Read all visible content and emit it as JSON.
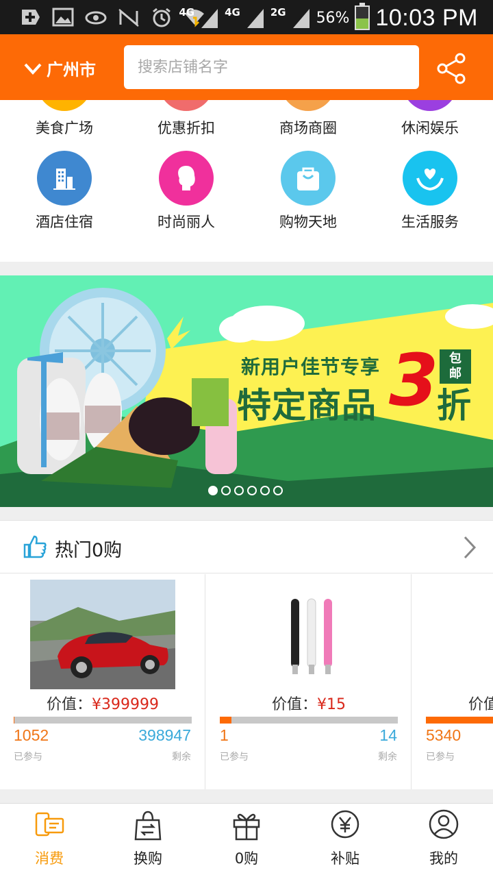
{
  "status_bar": {
    "network_1": "4G",
    "network_2": "4G",
    "network_3": "2G",
    "battery_percent": "56%",
    "time": "10:03 PM",
    "battery_level": 0.46
  },
  "header": {
    "city": "广州市",
    "search_placeholder": "搜索店铺名字",
    "accent_color": "#fd6a06"
  },
  "categories": [
    {
      "label": "美食广场",
      "icon": "food-icon",
      "color": "#ffb300"
    },
    {
      "label": "优惠折扣",
      "icon": "discount-icon",
      "color": "#f06c6c"
    },
    {
      "label": "商场商圈",
      "icon": "mall-icon",
      "color": "#f5a14a"
    },
    {
      "label": "休闲娱乐",
      "icon": "leisure-icon",
      "color": "#9b3fe0"
    },
    {
      "label": "酒店住宿",
      "icon": "hotel-icon",
      "color": "#3f88d0"
    },
    {
      "label": "时尚丽人",
      "icon": "beauty-icon",
      "color": "#f0309c"
    },
    {
      "label": "购物天地",
      "icon": "shopping-bag-icon",
      "color": "#5bc8ec"
    },
    {
      "label": "生活服务",
      "icon": "heart-hands-icon",
      "color": "#19c3ef"
    }
  ],
  "banner": {
    "line1": "新用户佳节专享",
    "line2": "特定商品",
    "big_number": "3",
    "suffix": "折",
    "badge_top": "包",
    "badge_bottom": "邮",
    "active_slide": 1,
    "slide_count": 6
  },
  "hot_section": {
    "title": "热门0购"
  },
  "products": [
    {
      "price_label": "价值：",
      "price": "¥399999",
      "joined": "1052",
      "remaining": "398947",
      "joined_label": "已参与",
      "remaining_label": "剩余",
      "progress": 0.003
    },
    {
      "price_label": "价值：",
      "price": "¥15",
      "joined": "1",
      "remaining": "14",
      "joined_label": "已参与",
      "remaining_label": "剩余",
      "progress": 0.067
    },
    {
      "price_label": "价值",
      "price": "",
      "joined": "5340",
      "remaining": "",
      "joined_label": "已参与",
      "remaining_label": "",
      "progress": 0.5
    }
  ],
  "tabs": [
    {
      "label": "消费",
      "icon": "consume-icon",
      "active": true
    },
    {
      "label": "换购",
      "icon": "exchange-bag-icon",
      "active": false
    },
    {
      "label": "0购",
      "icon": "gift-icon",
      "active": false
    },
    {
      "label": "补贴",
      "icon": "yen-coin-icon",
      "active": false
    },
    {
      "label": "我的",
      "icon": "profile-icon",
      "active": false
    }
  ]
}
